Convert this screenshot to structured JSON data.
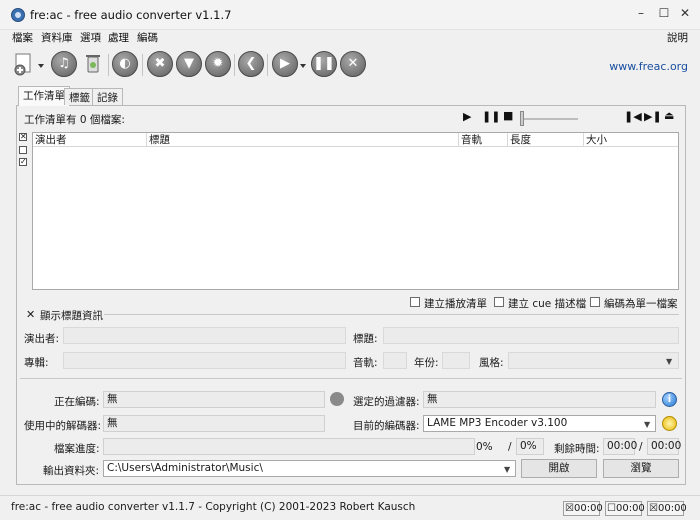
{
  "window": {
    "title": "fre:ac - free audio converter v1.1.7"
  },
  "menu": {
    "items": [
      "檔案",
      "資料庫",
      "選項",
      "處理",
      "編碼"
    ],
    "help": "說明"
  },
  "toolbar": {
    "link": "www.freac.org"
  },
  "tabs": [
    "工作清單",
    "標籤",
    "記錄"
  ],
  "joblist": {
    "count_text": "工作清單有 0 個檔案:",
    "columns": [
      "演出者",
      "標題",
      "音軌",
      "長度",
      "大小"
    ],
    "options": [
      "建立播放清單",
      "建立 cue 描述檔",
      "編碼為單一檔案"
    ]
  },
  "title_info": {
    "toggle_label": "顯示標題資訊",
    "artist_label": "演出者:",
    "title_label": "標題:",
    "album_label": "專輯:",
    "track_label": "音軌:",
    "year_label": "年份:",
    "genre_label": "風格:"
  },
  "status": {
    "encoding_label": "正在編碼:",
    "encoding_value": "無",
    "filter_label": "選定的過濾器:",
    "filter_value": "無",
    "decoder_label": "使用中的解碼器:",
    "decoder_value": "無",
    "encoder_label": "目前的編碼器:",
    "encoder_value": "LAME MP3 Encoder v3.100",
    "progress_label": "檔案進度:",
    "progress_file": "0%",
    "progress_sep": "/",
    "progress_total": "0%",
    "remaining_label": "剩餘時間:",
    "remaining_file": "00:00",
    "remaining_sep": "/",
    "remaining_total": "00:00",
    "output_label": "輸出資料夾:",
    "output_value": "C:\\Users\\Administrator\\Music\\",
    "open_button": "開啟",
    "browse_button": "瀏覽"
  },
  "statusbar": {
    "text": "fre:ac - free audio converter v1.1.7 - Copyright (C) 2001-2023 Robert Kausch",
    "t1": "00:00",
    "t2": "00:00",
    "t3": "00:00"
  }
}
